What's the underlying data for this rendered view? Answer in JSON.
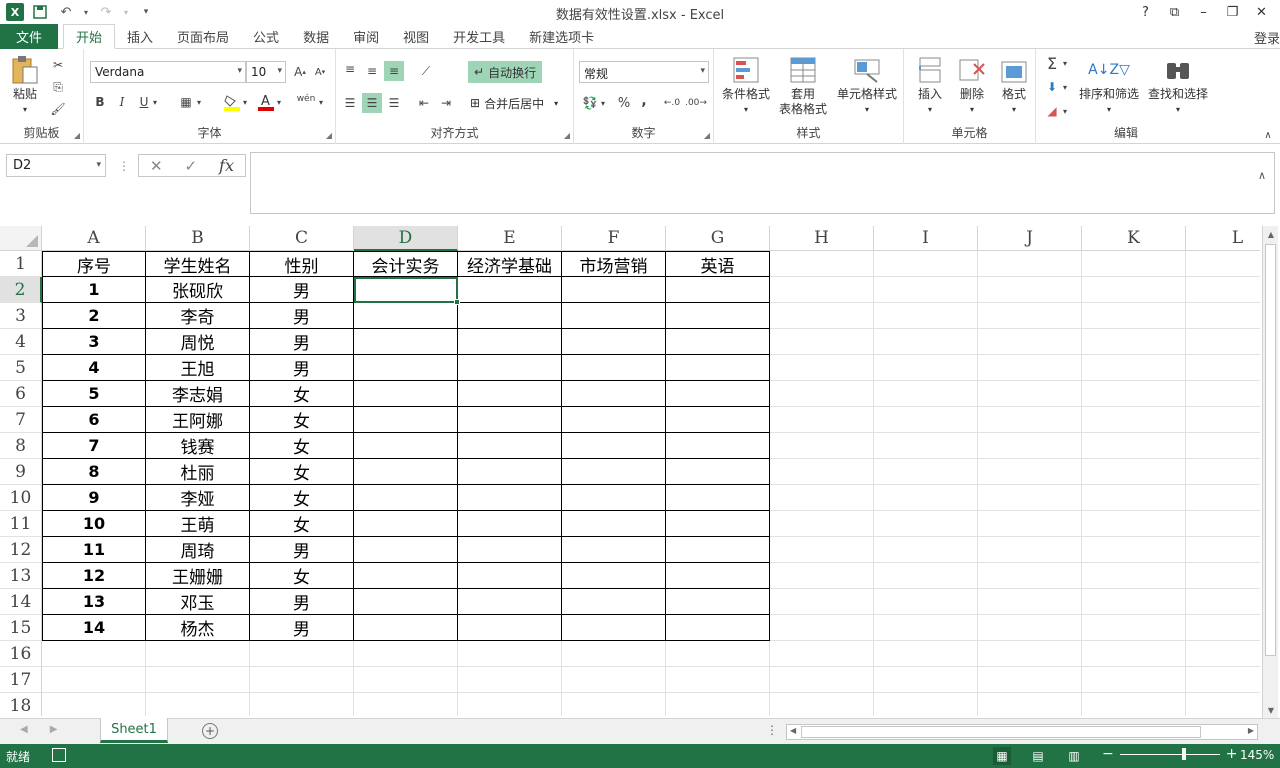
{
  "window": {
    "title": "数据有效性设置.xlsx - Excel",
    "login": "登录"
  },
  "menu": {
    "file": "文件",
    "tabs": [
      "开始",
      "插入",
      "页面布局",
      "公式",
      "数据",
      "审阅",
      "视图",
      "开发工具",
      "新建选项卡"
    ]
  },
  "ribbon": {
    "clipboard": {
      "label": "剪贴板",
      "paste": "粘贴"
    },
    "font": {
      "label": "字体",
      "name": "Verdana",
      "size": "10",
      "bold": "B",
      "italic": "I",
      "underline": "U",
      "wen": "wén"
    },
    "alignment": {
      "label": "对齐方式",
      "wrap": "自动换行",
      "merge": "合并后居中"
    },
    "number": {
      "label": "数字",
      "format": "常规",
      "percent": "%",
      "comma": ","
    },
    "styles": {
      "label": "样式",
      "conditional": "条件格式",
      "table_line1": "套用",
      "table_line2": "表格格式",
      "cell_styles": "单元格样式"
    },
    "cells": {
      "label": "单元格",
      "insert": "插入",
      "delete": "删除",
      "format": "格式"
    },
    "editing": {
      "label": "编辑",
      "sort_filter": "排序和筛选",
      "find_select": "查找和选择"
    }
  },
  "formula_bar": {
    "name_box": "D2",
    "fx": "fx",
    "value": ""
  },
  "sheet": {
    "columns": [
      "A",
      "B",
      "C",
      "D",
      "E",
      "F",
      "G",
      "H",
      "I",
      "J",
      "K",
      "L"
    ],
    "selected_column": "D",
    "selected_row": 2,
    "active_cell": "D2",
    "headers": [
      "序号",
      "学生姓名",
      "性别",
      "会计实务",
      "经济学基础",
      "市场营销",
      "英语"
    ],
    "rows": [
      {
        "num": "1",
        "name": "张砚欣",
        "gender": "男"
      },
      {
        "num": "2",
        "name": "李奇",
        "gender": "男"
      },
      {
        "num": "3",
        "name": "周悦",
        "gender": "男"
      },
      {
        "num": "4",
        "name": "王旭",
        "gender": "男"
      },
      {
        "num": "5",
        "name": "李志娟",
        "gender": "女"
      },
      {
        "num": "6",
        "name": "王阿娜",
        "gender": "女"
      },
      {
        "num": "7",
        "name": "钱赛",
        "gender": "女"
      },
      {
        "num": "8",
        "name": "杜丽",
        "gender": "女"
      },
      {
        "num": "9",
        "name": "李娅",
        "gender": "女"
      },
      {
        "num": "10",
        "name": "王萌",
        "gender": "女"
      },
      {
        "num": "11",
        "name": "周琦",
        "gender": "男"
      },
      {
        "num": "12",
        "name": "王姗姗",
        "gender": "女"
      },
      {
        "num": "13",
        "name": "邓玉",
        "gender": "男"
      },
      {
        "num": "14",
        "name": "杨杰",
        "gender": "男"
      }
    ],
    "row_numbers": [
      "1",
      "2",
      "3",
      "4",
      "5",
      "6",
      "7",
      "8",
      "9",
      "10",
      "11",
      "12",
      "13",
      "14",
      "15",
      "16",
      "17",
      "18"
    ]
  },
  "sheet_tabs": {
    "active": "Sheet1"
  },
  "status": {
    "ready": "就绪",
    "zoom": "145%"
  },
  "colors": {
    "accent": "#217346",
    "highlight": "#9fd5b7"
  }
}
